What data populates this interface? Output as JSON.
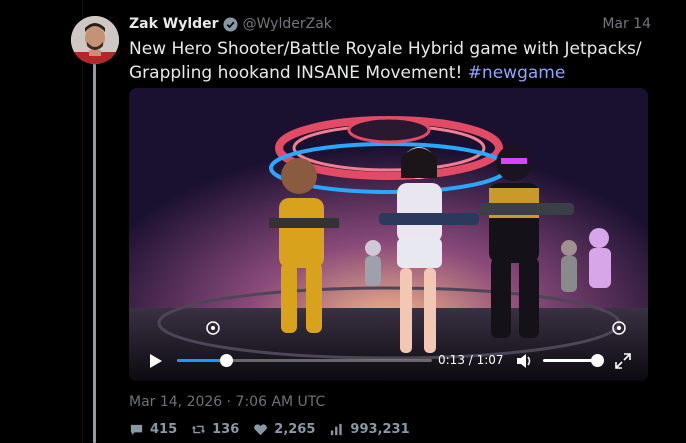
{
  "tweet": {
    "author": {
      "display_name": "Zak Wylder",
      "handle": "@WylderZak",
      "verified": true
    },
    "date": "Mar 14",
    "text_main": "New Hero Shooter/Battle Royale Hybrid game with Jetpacks/ Grappling hookand INSANE Movement!",
    "hashtag": "#newgame",
    "timestamp": "Mar 14, 2026 · 7:06 AM UTC"
  },
  "video": {
    "current_time": "0:13",
    "duration": "1:07",
    "time_display": "0:13 / 1:07",
    "progress": 0.194,
    "volume": 1.0,
    "play_icon": "play-icon",
    "volume_icon": "speaker-icon",
    "fullscreen_icon": "fullscreen-icon"
  },
  "stats": {
    "replies": "415",
    "retweets": "136",
    "likes": "2,265",
    "views": "993,231"
  },
  "colors": {
    "background": "#000000",
    "text": "#e7e9ea",
    "muted": "#71767b",
    "hashtag": "#8fa6ff",
    "accent": "#1d9bf0",
    "thread_line": "#8f9ea6"
  }
}
